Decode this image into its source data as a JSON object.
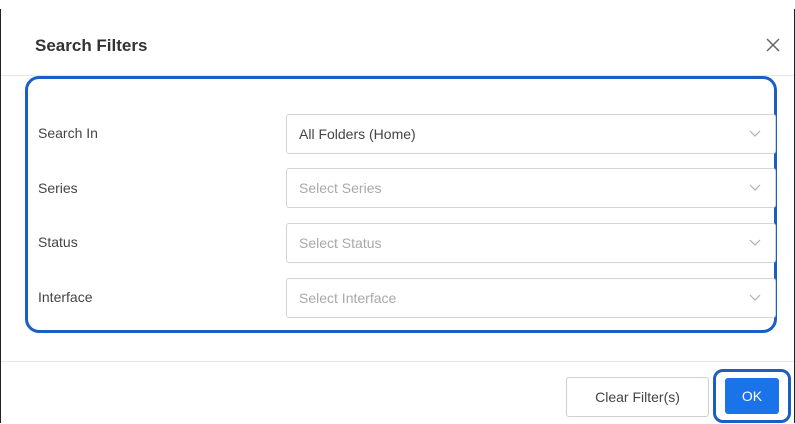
{
  "dialog": {
    "title": "Search Filters",
    "close_icon": "close-icon"
  },
  "filters": [
    {
      "label": "Search In",
      "value": "All Folders (Home)",
      "placeholder": "",
      "is_placeholder": false
    },
    {
      "label": "Series",
      "value": "Select Series",
      "placeholder": "Select Series",
      "is_placeholder": true
    },
    {
      "label": "Status",
      "value": "Select Status",
      "placeholder": "Select Status",
      "is_placeholder": true
    },
    {
      "label": "Interface",
      "value": "Select Interface",
      "placeholder": "Select Interface",
      "is_placeholder": true
    }
  ],
  "footer": {
    "clear_label": "Clear Filter(s)",
    "ok_label": "OK"
  },
  "colors": {
    "accent": "#1a73e8",
    "focus_ring": "#1c5fc4"
  }
}
